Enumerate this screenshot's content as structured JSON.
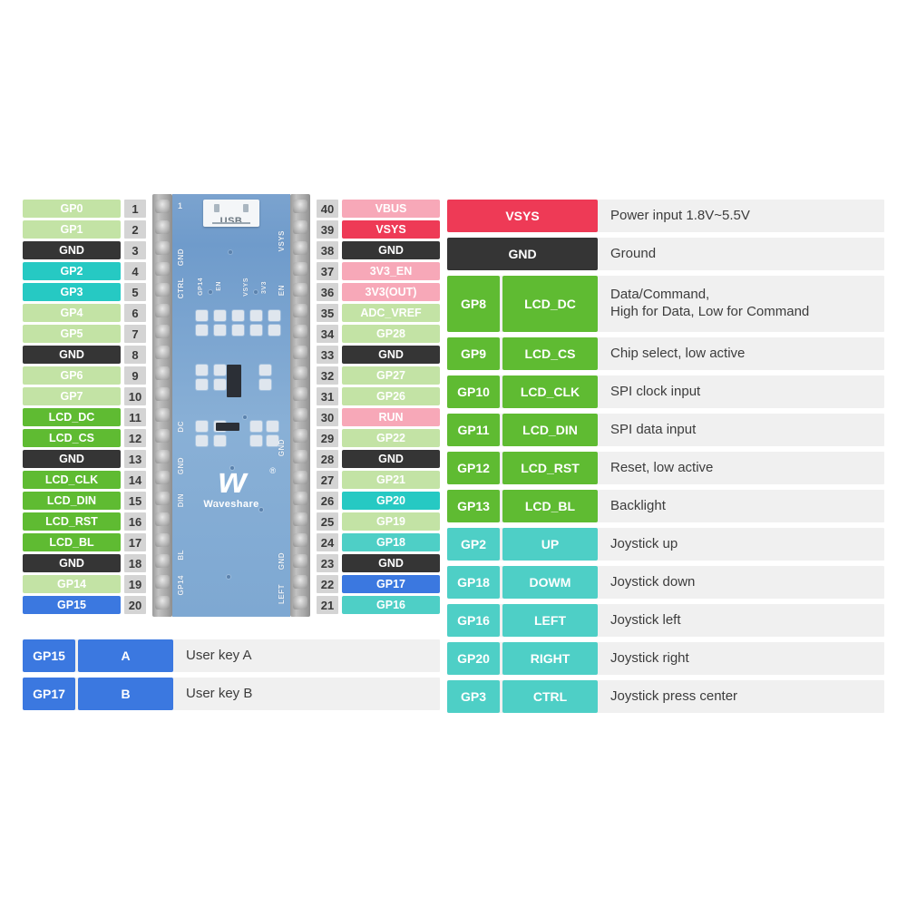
{
  "board": {
    "name": "board-photo",
    "usb_label": "USB",
    "brand": "Waveshare",
    "brand_mark": "w",
    "registered_mark": "®",
    "pcb_color": "#7ba3cf",
    "silk_left": [
      "GND",
      "CTRL",
      "GP14",
      "EN",
      "DC",
      "GND",
      "DIN",
      "BL",
      "GP14"
    ],
    "silk_right": [
      "VSYS",
      "VSYS",
      "3V3",
      "EN",
      "GND",
      "GND",
      "LEFT"
    ],
    "pin1_marker": "1"
  },
  "colors": {
    "light_green": "#c3e3a5",
    "bright_green": "#5fbb32",
    "dark": "#353535",
    "cyan": "#26c9c3",
    "teal": "#4ecfc6",
    "blue": "#3b78e0",
    "pink": "#f7a8b8",
    "crimson": "#ee3a56",
    "pin_number_bg": "#d4d4d4",
    "row_bg": "#f0f0f0"
  },
  "left_pins": [
    {
      "num": "1",
      "label": "GP0",
      "color": "light_green"
    },
    {
      "num": "2",
      "label": "GP1",
      "color": "light_green"
    },
    {
      "num": "3",
      "label": "GND",
      "color": "dark"
    },
    {
      "num": "4",
      "label": "GP2",
      "color": "cyan"
    },
    {
      "num": "5",
      "label": "GP3",
      "color": "cyan"
    },
    {
      "num": "6",
      "label": "GP4",
      "color": "light_green"
    },
    {
      "num": "7",
      "label": "GP5",
      "color": "light_green"
    },
    {
      "num": "8",
      "label": "GND",
      "color": "dark"
    },
    {
      "num": "9",
      "label": "GP6",
      "color": "light_green"
    },
    {
      "num": "10",
      "label": "GP7",
      "color": "light_green"
    },
    {
      "num": "11",
      "label": "LCD_DC",
      "color": "bright_green"
    },
    {
      "num": "12",
      "label": "LCD_CS",
      "color": "bright_green"
    },
    {
      "num": "13",
      "label": "GND",
      "color": "dark"
    },
    {
      "num": "14",
      "label": "LCD_CLK",
      "color": "bright_green"
    },
    {
      "num": "15",
      "label": "LCD_DIN",
      "color": "bright_green"
    },
    {
      "num": "16",
      "label": "LCD_RST",
      "color": "bright_green"
    },
    {
      "num": "17",
      "label": "LCD_BL",
      "color": "bright_green"
    },
    {
      "num": "18",
      "label": "GND",
      "color": "dark"
    },
    {
      "num": "19",
      "label": "GP14",
      "color": "light_green"
    },
    {
      "num": "20",
      "label": "GP15",
      "color": "blue"
    }
  ],
  "right_pins": [
    {
      "num": "40",
      "label": "VBUS",
      "color": "pink"
    },
    {
      "num": "39",
      "label": "VSYS",
      "color": "crimson"
    },
    {
      "num": "38",
      "label": "GND",
      "color": "dark"
    },
    {
      "num": "37",
      "label": "3V3_EN",
      "color": "pink"
    },
    {
      "num": "36",
      "label": "3V3(OUT)",
      "color": "pink"
    },
    {
      "num": "35",
      "label": "ADC_VREF",
      "color": "light_green"
    },
    {
      "num": "34",
      "label": "GP28",
      "color": "light_green"
    },
    {
      "num": "33",
      "label": "GND",
      "color": "dark"
    },
    {
      "num": "32",
      "label": "GP27",
      "color": "light_green"
    },
    {
      "num": "31",
      "label": "GP26",
      "color": "light_green"
    },
    {
      "num": "30",
      "label": "RUN",
      "color": "pink"
    },
    {
      "num": "29",
      "label": "GP22",
      "color": "light_green"
    },
    {
      "num": "28",
      "label": "GND",
      "color": "dark"
    },
    {
      "num": "27",
      "label": "GP21",
      "color": "light_green"
    },
    {
      "num": "26",
      "label": "GP20",
      "color": "cyan"
    },
    {
      "num": "25",
      "label": "GP19",
      "color": "light_green"
    },
    {
      "num": "24",
      "label": "GP18",
      "color": "teal"
    },
    {
      "num": "23",
      "label": "GND",
      "color": "dark"
    },
    {
      "num": "22",
      "label": "GP17",
      "color": "blue"
    },
    {
      "num": "21",
      "label": "GP16",
      "color": "teal"
    }
  ],
  "legend_right": [
    {
      "gp": null,
      "fn": "VSYS",
      "desc": "Power input 1.8V~5.5V",
      "color": "crimson",
      "tall": false
    },
    {
      "gp": null,
      "fn": "GND",
      "desc": "Ground",
      "color": "dark",
      "tall": false
    },
    {
      "gp": "GP8",
      "fn": "LCD_DC",
      "desc": "Data/Command,\nHigh for Data, Low for Command",
      "color": "bright_green",
      "tall": true
    },
    {
      "gp": "GP9",
      "fn": "LCD_CS",
      "desc": "Chip select, low active",
      "color": "bright_green",
      "tall": false
    },
    {
      "gp": "GP10",
      "fn": "LCD_CLK",
      "desc": "SPI clock input",
      "color": "bright_green",
      "tall": false
    },
    {
      "gp": "GP11",
      "fn": "LCD_DIN",
      "desc": "SPI data input",
      "color": "bright_green",
      "tall": false
    },
    {
      "gp": "GP12",
      "fn": "LCD_RST",
      "desc": "Reset, low active",
      "color": "bright_green",
      "tall": false
    },
    {
      "gp": "GP13",
      "fn": "LCD_BL",
      "desc": "Backlight",
      "color": "bright_green",
      "tall": false
    },
    {
      "gp": "GP2",
      "fn": "UP",
      "desc": "Joystick up",
      "color": "teal",
      "tall": false
    },
    {
      "gp": "GP18",
      "fn": "DOWM",
      "desc": "Joystick down",
      "color": "teal",
      "tall": false
    },
    {
      "gp": "GP16",
      "fn": "LEFT",
      "desc": "Joystick left",
      "color": "teal",
      "tall": false
    },
    {
      "gp": "GP20",
      "fn": "RIGHT",
      "desc": "Joystick right",
      "color": "teal",
      "tall": false
    },
    {
      "gp": "GP3",
      "fn": "CTRL",
      "desc": "Joystick press center",
      "color": "teal",
      "tall": false
    }
  ],
  "legend_bottom_left": [
    {
      "gp": "GP15",
      "fn": "A",
      "desc": "User key A",
      "color": "blue",
      "tall": false
    },
    {
      "gp": "GP17",
      "fn": "B",
      "desc": "User key B",
      "color": "blue",
      "tall": false
    }
  ]
}
